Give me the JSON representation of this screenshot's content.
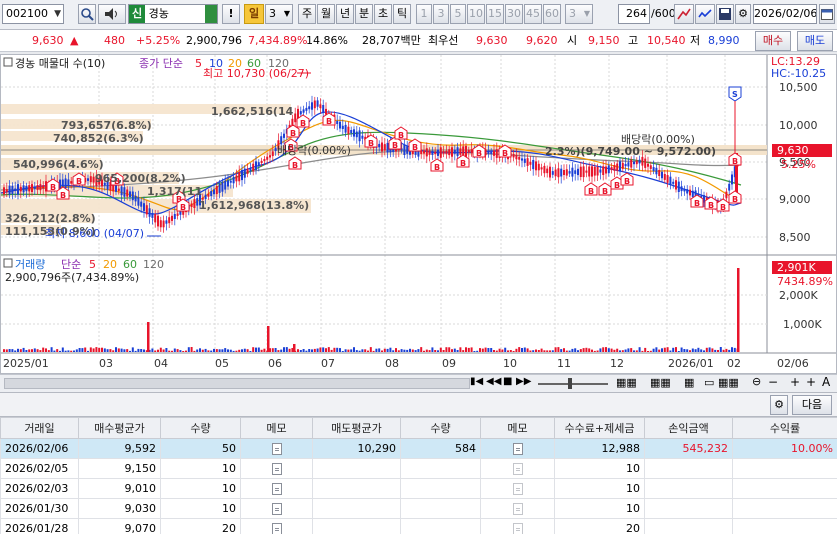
{
  "toolbar": {
    "code": "002100",
    "new_badge": "신",
    "name": "경농",
    "excl": "!",
    "period_label": "일",
    "period_value": "3",
    "periods": [
      "주",
      "월",
      "년",
      "분",
      "초",
      "틱"
    ],
    "numbers": [
      "1",
      "3",
      "5",
      "10",
      "15",
      "30",
      "45",
      "60"
    ],
    "tick_value": "3",
    "count": "264",
    "total": "/600",
    "date": "2026/02/06"
  },
  "quote": {
    "price": "9,630",
    "change_arrow": "▲",
    "change": "480",
    "change_pct": "+5.25%",
    "volume": "2,900,796",
    "volume_pct": "7,434.89%",
    "turnover": "14.86%",
    "amount": "28,707백만",
    "best_label": "최우선",
    "ask": "9,630",
    "bid": "9,620",
    "open_label": "시",
    "open": "9,150",
    "high_label": "고",
    "high": "10,540",
    "low_label": "저",
    "low": "8,990",
    "buy_label": "매수",
    "sell_label": "매도"
  },
  "chart": {
    "legend_title": "경농 매물대 수(10)",
    "legend_price": "종가 단순",
    "ma_labels": [
      "5",
      "10",
      "20",
      "60",
      "120"
    ],
    "lc": "LC:13.29",
    "hc": "HC:-10.25",
    "high_annot": "최고 10,730 (06/27)",
    "low_annot": "최저 8,600 (04/07)",
    "vol_profile": [
      "1,662,516(14",
      "793,657(6.8%)",
      "740,852(6.3%)",
      "540,996(4.6%)",
      "965,200(8.2%)",
      "1,317(11",
      "1,612,968(13.8%)",
      "326,212(2.8%)",
      "111,153(0.9%)"
    ],
    "div_labels": [
      "배당락(0.00%)",
      "배당락(0.00%)"
    ],
    "mid_annot": "2.3%)(9,749.00 ~ 9,572.00)",
    "price_axis": [
      "10,500",
      "10,000",
      "9,500",
      "9,000",
      "8,500"
    ],
    "current_price": "9,630",
    "current_pct": "5.25%",
    "vol_title": "거래량",
    "vol_ma": "단순",
    "vol_ma_labels": [
      "5",
      "20",
      "60",
      "120"
    ],
    "vol_value": "2,900,796주(7,434.89%)",
    "vol_axis": [
      "2,000K",
      "1,000K"
    ],
    "vol_current": "2,901K",
    "vol_current_pct": "7434.89%",
    "x_labels": [
      "2025/01",
      "03",
      "04",
      "05",
      "06",
      "07",
      "08",
      "09",
      "10",
      "11",
      "12",
      "2026/01",
      "02",
      "02/06"
    ]
  },
  "table": {
    "next_label": "다음",
    "headers": [
      "거래일",
      "매수평균가",
      "수량",
      "메모",
      "매도평균가",
      "수량",
      "메모",
      "수수료+제세금",
      "손익금액",
      "수익률"
    ],
    "rows": [
      [
        "2026/02/06",
        "9,592",
        "50",
        "",
        "10,290",
        "584",
        "",
        "12,988",
        "545,232",
        "10.00%"
      ],
      [
        "2026/02/05",
        "9,150",
        "10",
        "",
        "",
        "",
        "",
        "10",
        "",
        ""
      ],
      [
        "2026/02/03",
        "9,010",
        "10",
        "",
        "",
        "",
        "",
        "10",
        "",
        ""
      ],
      [
        "2026/01/30",
        "9,030",
        "10",
        "",
        "",
        "",
        "",
        "10",
        "",
        ""
      ],
      [
        "2026/01/28",
        "9,070",
        "20",
        "",
        "",
        "",
        "",
        "20",
        "",
        ""
      ]
    ]
  },
  "colors": {
    "up": "#e8142b",
    "down": "#1a3fd6",
    "ma5": "#e8142b",
    "ma10": "#1a3fd6",
    "ma20": "#f29a00",
    "ma60": "#3a9a3a",
    "ma120": "#6c6c6c",
    "profile": "#f6e5cf"
  }
}
